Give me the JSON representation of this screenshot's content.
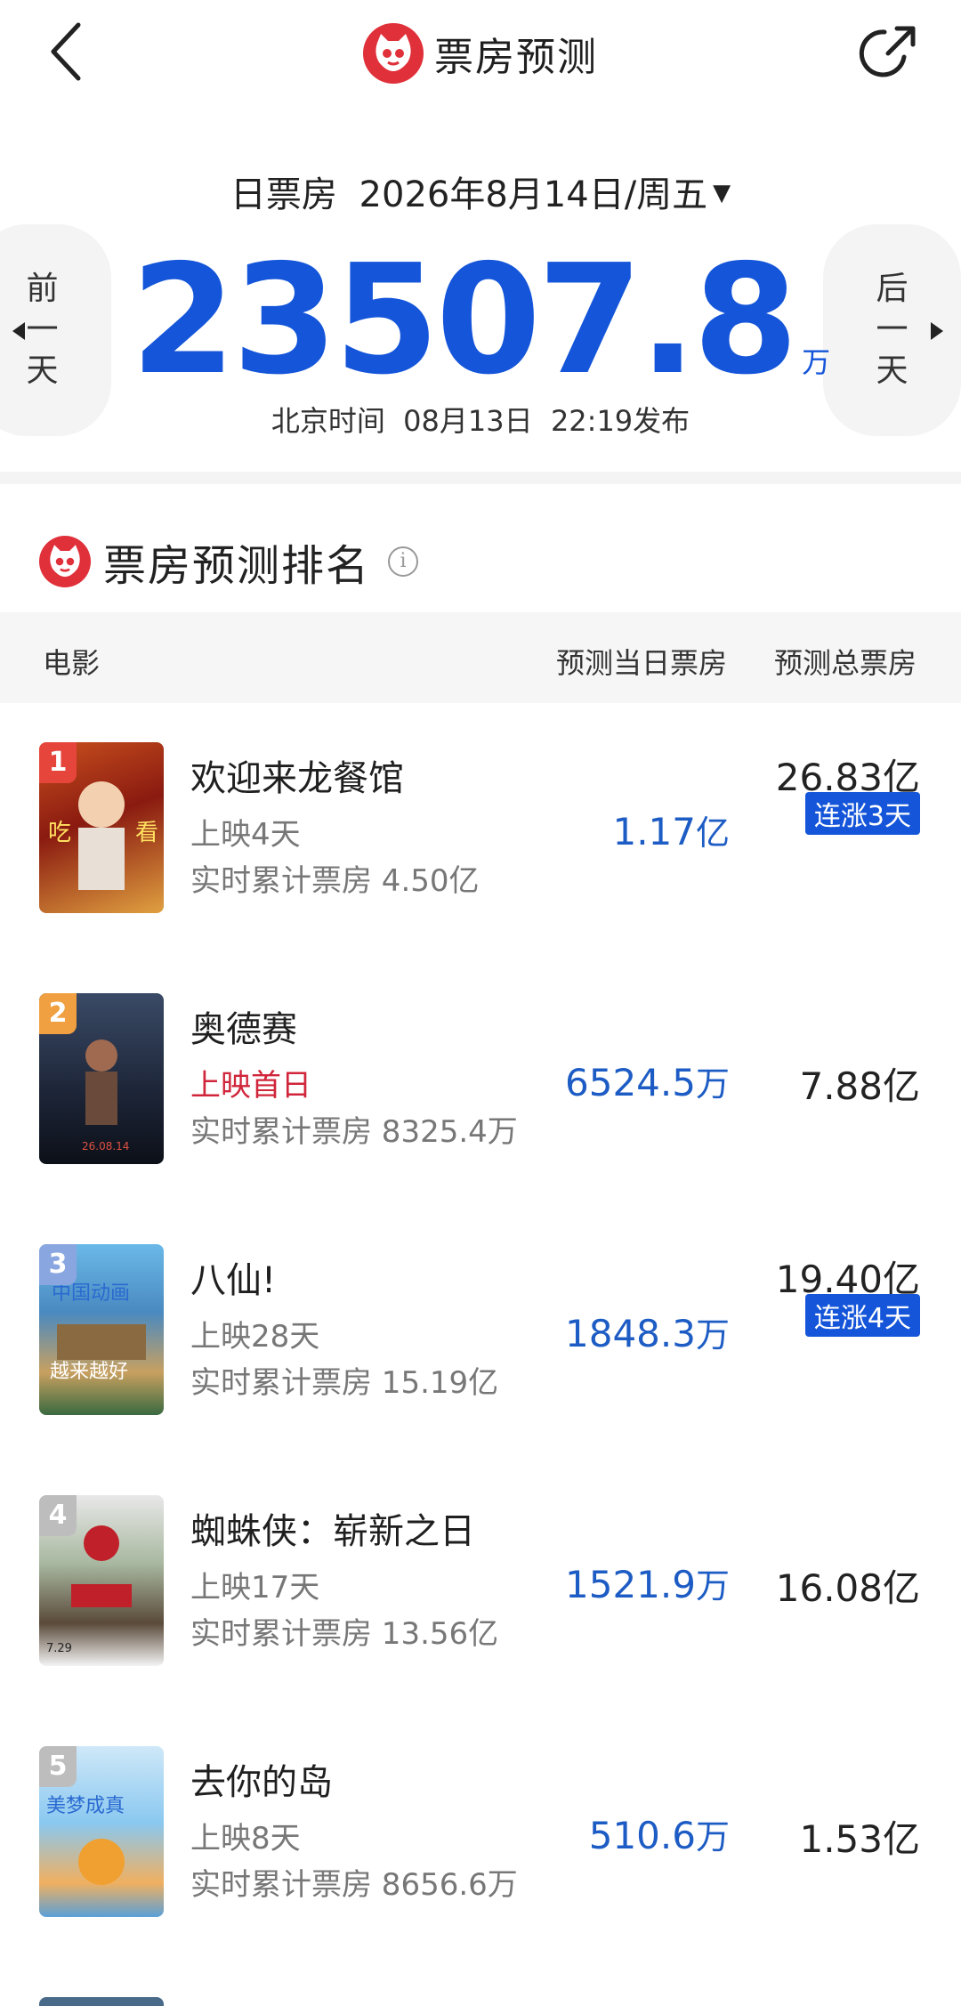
{
  "nav": {
    "title": "票房预测"
  },
  "header": {
    "date_prefix": "日票房",
    "date": "2026年8月14日/周五",
    "prev_day": [
      "前",
      "一",
      "天"
    ],
    "next_day": [
      "后",
      "一",
      "天"
    ],
    "box_office_value": "23507.8",
    "box_office_unit": "万",
    "publish_time": "北京时间  08月13日  22:19发布"
  },
  "section": {
    "title": "票房预测排名",
    "info": "i"
  },
  "table_header": {
    "movie": "电影",
    "daily": "预测当日票房",
    "total": "预测总票房"
  },
  "movies": [
    {
      "rank": "1",
      "title": "欢迎来龙餐馆",
      "status": "上映4天",
      "cumulative": "实时累计票房 4.50亿",
      "daily_value": "1.17",
      "daily_unit": "亿",
      "total": "26.83亿",
      "badge": "连涨3天",
      "rank_color": "#e5453b"
    },
    {
      "rank": "2",
      "title": "奥德赛",
      "status": "上映首日",
      "cumulative": "实时累计票房 8325.4万",
      "daily_value": "6524.5",
      "daily_unit": "万",
      "total": "7.88亿",
      "badge": "",
      "rank_color": "#f0a040"
    },
    {
      "rank": "3",
      "title": "八仙!",
      "status": "上映28天",
      "cumulative": "实时累计票房 15.19亿",
      "daily_value": "1848.3",
      "daily_unit": "万",
      "total": "19.40亿",
      "badge": "连涨4天",
      "rank_color": "#8aa6e0"
    },
    {
      "rank": "4",
      "title": "蜘蛛侠：崭新之日",
      "status": "上映17天",
      "cumulative": "实时累计票房 13.56亿",
      "daily_value": "1521.9",
      "daily_unit": "万",
      "total": "16.08亿",
      "badge": "",
      "rank_color": "#bdbdbd"
    },
    {
      "rank": "5",
      "title": "去你的岛",
      "status": "上映8天",
      "cumulative": "实时累计票房 8656.6万",
      "daily_value": "510.6",
      "daily_unit": "万",
      "total": "1.53亿",
      "badge": "",
      "rank_color": "#bdbdbd"
    }
  ],
  "colors": {
    "accent_blue": "#1455d9",
    "brand_red": "#e0303a",
    "first_day_red": "#d0253a"
  }
}
